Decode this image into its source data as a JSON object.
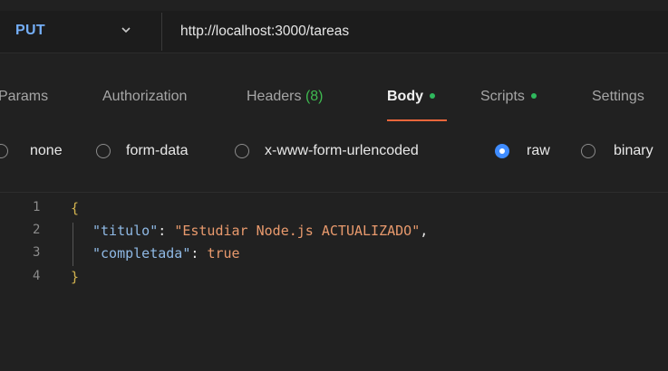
{
  "request": {
    "method": "PUT",
    "url": "http://localhost:3000/tareas"
  },
  "tabs": [
    {
      "label": "Params"
    },
    {
      "label": "Authorization"
    },
    {
      "label": "Headers",
      "count": "(8)"
    },
    {
      "label": "Body",
      "active": true
    },
    {
      "label": "Scripts"
    },
    {
      "label": "Settings"
    }
  ],
  "body_types": [
    {
      "label": "none"
    },
    {
      "label": "form-data"
    },
    {
      "label": "x-www-form-urlencoded"
    },
    {
      "label": "raw",
      "selected": true
    },
    {
      "label": "binary"
    }
  ],
  "editor": {
    "lines": [
      {
        "number": "1",
        "open": "{"
      },
      {
        "number": "2",
        "key": "\"titulo\"",
        "colon": ": ",
        "value": "\"Estudiar Node.js ACTUALIZADO\"",
        "trail": ","
      },
      {
        "number": "3",
        "key": "\"completada\"",
        "colon": ": ",
        "value": "true",
        "trail": ""
      },
      {
        "number": "4",
        "close": "}"
      }
    ]
  },
  "colors": {
    "method": "#74aef6",
    "accent_underline": "#e8663b",
    "status_dot": "#2fb85d",
    "radio_selected": "#3f8cff"
  }
}
